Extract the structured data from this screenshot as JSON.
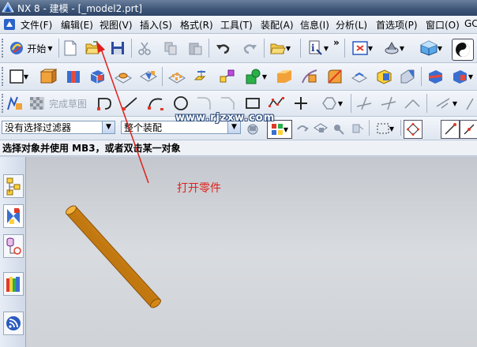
{
  "titlebar": {
    "title": "NX 8 - 建模 - [_model2.prt]"
  },
  "menu": {
    "items": [
      "文件(F)",
      "编辑(E)",
      "视图(V)",
      "插入(S)",
      "格式(R)",
      "工具(T)",
      "装配(A)",
      "信息(I)",
      "分析(L)",
      "首选项(P)",
      "窗口(O)",
      "GC"
    ]
  },
  "toolbar1": {
    "start_label": "开始",
    "more_label": "»"
  },
  "toolbar3": {
    "sketch_label": "完成草图"
  },
  "selection": {
    "filter_value": "没有选择过滤器",
    "scope_value": "整个装配"
  },
  "prompt": {
    "text": "选择对象并使用 MB3，或者双击某一对象"
  },
  "annotation": {
    "text": "打开零件"
  },
  "watermark": {
    "text": "www.rjzxw.com"
  },
  "colors": {
    "cylinder": "#f0a020",
    "annotation": "#e0201a",
    "titlebar": "#3d5577"
  }
}
